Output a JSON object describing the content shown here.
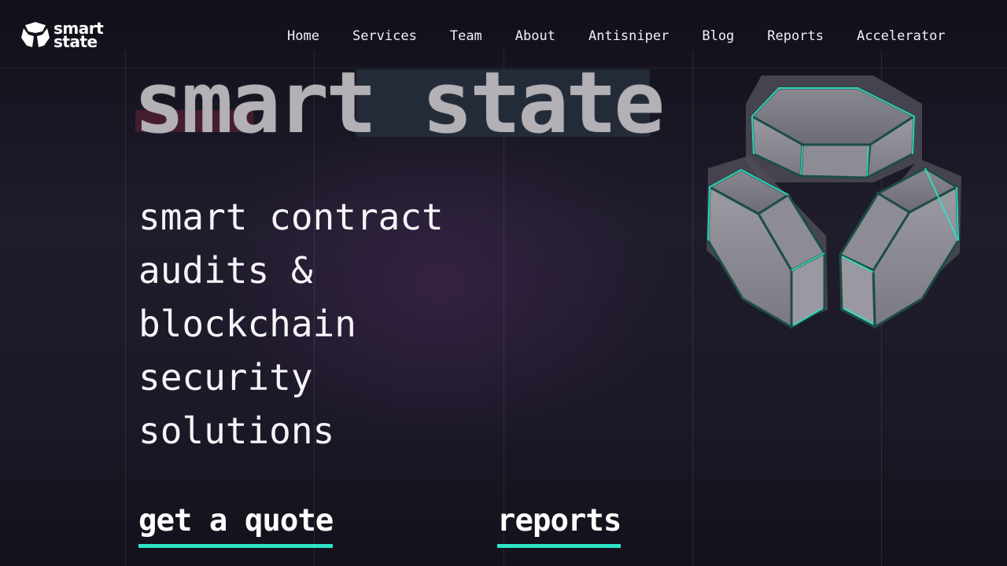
{
  "brand": {
    "logo_line1": "smart",
    "logo_line2": "state"
  },
  "nav": {
    "items": [
      "Home",
      "Services",
      "Team",
      "About",
      "Antisniper",
      "Blog",
      "Reports",
      "Accelerator"
    ]
  },
  "hero": {
    "big_title": "smart state",
    "tagline_lines": [
      "smart contract",
      "audits &",
      "blockchain",
      "security",
      "solutions"
    ],
    "cta_quote": "get a quote",
    "cta_reports": "reports"
  },
  "colors": {
    "accent": "#2fe3c6",
    "background": "#1b1827",
    "text": "#f3f1f6"
  },
  "icons": {
    "logo": "three-hexagon-segments-logo-icon",
    "illustration": "3d-hexagon-segments-illustration"
  }
}
